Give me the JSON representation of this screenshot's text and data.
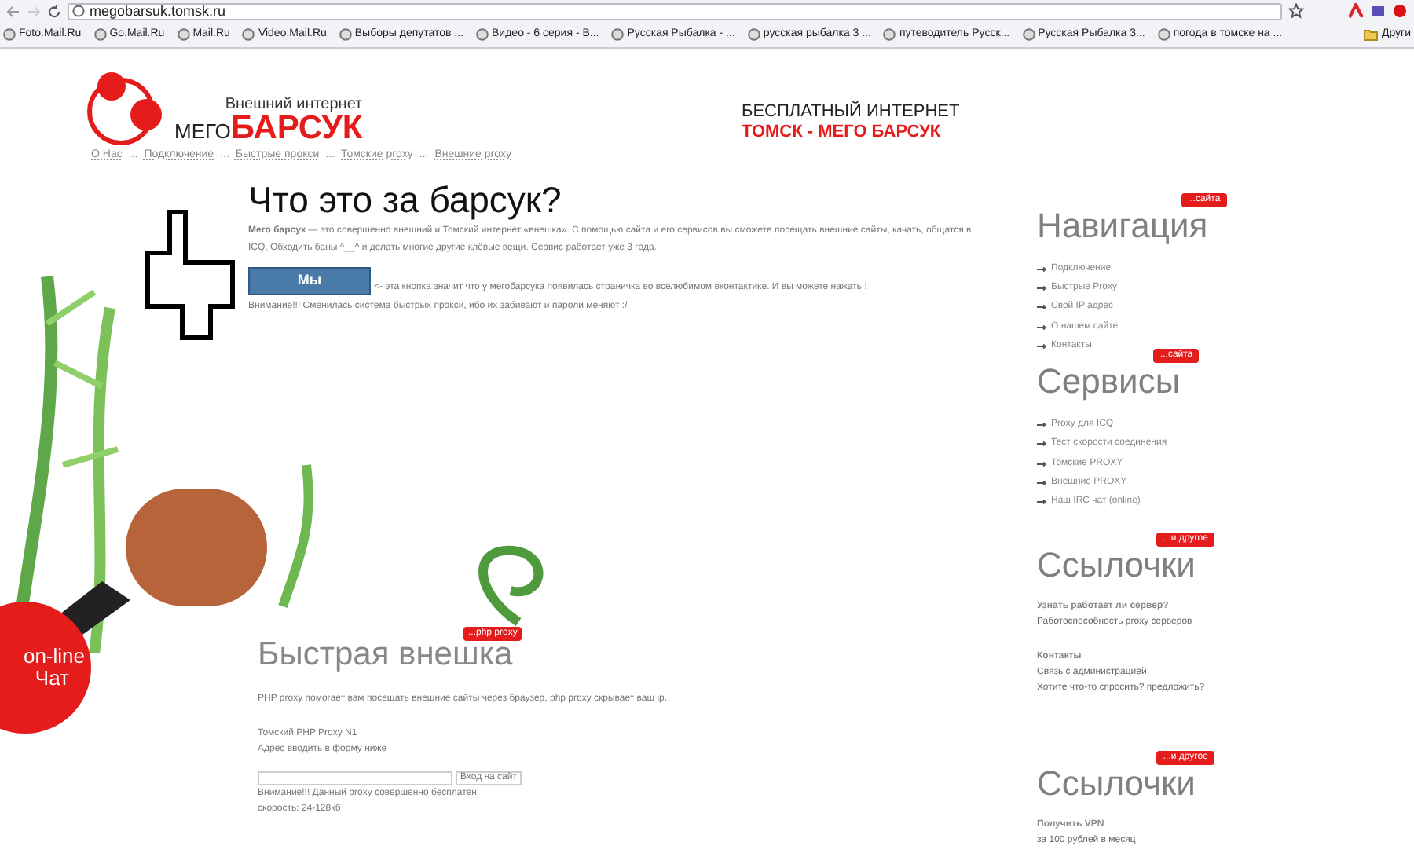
{
  "browser": {
    "url": "megobarsuk.tomsk.ru",
    "bookmarks": [
      "Foto.Mail.Ru",
      "Go.Mail.Ru",
      "Mail.Ru",
      "Video.Mail.Ru",
      "Выборы депутатов ...",
      "Видео - 6 серия - В...",
      "Русская Рыбалка - ...",
      "русская рыбалка 3 ...",
      "путеводитель Русск...",
      "Русская Рыбалка 3...",
      "погода в томске на ..."
    ],
    "other_bookmarks": "Други"
  },
  "header": {
    "logo_top": "Внешний интернет",
    "logo_prefix": "МЕГО",
    "logo_name": "БАРСУК",
    "nav_links": [
      "О Нас",
      "Подключение",
      "Быстрые прокси",
      "Томские proxy",
      "Внешние proxy"
    ],
    "separator": "...",
    "tagline": "БЕСПЛАТНЫЙ ИНТЕРНЕТ",
    "tagline_sub": "ТОМСК - МЕГО БАРСУК"
  },
  "about": {
    "title": "Что это за барсук?",
    "intro": "**Мего барсук** — это совершенно внешний и Томский интернет «внешка». С помощью сайта и его сервисов вы сможете посещать внешние сайты, качать, общатся в ICQ, Обходить баны ^__^ и делать многие другие клёвые вещи. Сервис работает уже 3 года.",
    "vk_button": "Мы",
    "vk_note": "<- эта кнопка значит что у мегобарсука появилась страничка во вселюбимом вконтактике. И вы можете нажать !",
    "warning": "Внимание!!! Сменилась система быстрых прокси, ибо их забивают и пароли меняют :/"
  },
  "chat_badge": {
    "line1": "on-line",
    "line2": "Чат"
  },
  "proxy": {
    "tag": "...php proxy",
    "title": "Быстрая внешка",
    "description": "PHP proxy помогает вам посещать внешние сайты через браузер, php proxy скрывает ваш ip.",
    "name": "Томский PHP Proxy N1",
    "hint": "Адрес вводить в форму ниже",
    "button": "Вход на сайт",
    "warning": "Внимание!!! Данный proxy совершенно бесплатен",
    "speed": "скорость: 24-128кб"
  },
  "sidebar": [
    {
      "kind": "list",
      "tag": "...сайта",
      "title": "Навигация",
      "items": [
        "Подключение",
        "Быстрые Proxy",
        "Свой IP адрес",
        "О нашем сайте",
        "Контакты"
      ]
    },
    {
      "kind": "list",
      "tag": "...сайта",
      "title": "Сервисы",
      "items": [
        "Proxy для ICQ",
        "Тест скорости соединения",
        "Томские PROXY",
        "Внешние PROXY",
        "Наш IRC чат (online)"
      ]
    },
    {
      "kind": "links",
      "tag": "...и другое",
      "title": "Ссылочки",
      "groups": [
        {
          "heading": "Узнать работает ли сервер?",
          "lines": [
            "Работоспособность proxy серверов"
          ]
        },
        {
          "heading": "Контакты",
          "lines": [
            "Связь с администрацией",
            "Хотите что-то спросить? предложить?"
          ]
        }
      ]
    },
    {
      "kind": "links",
      "tag": "...и другое",
      "title": "Ссылочки",
      "groups": [
        {
          "heading": "Получить VPN",
          "lines": [
            "за 100 рублей в месяц"
          ]
        }
      ]
    }
  ]
}
